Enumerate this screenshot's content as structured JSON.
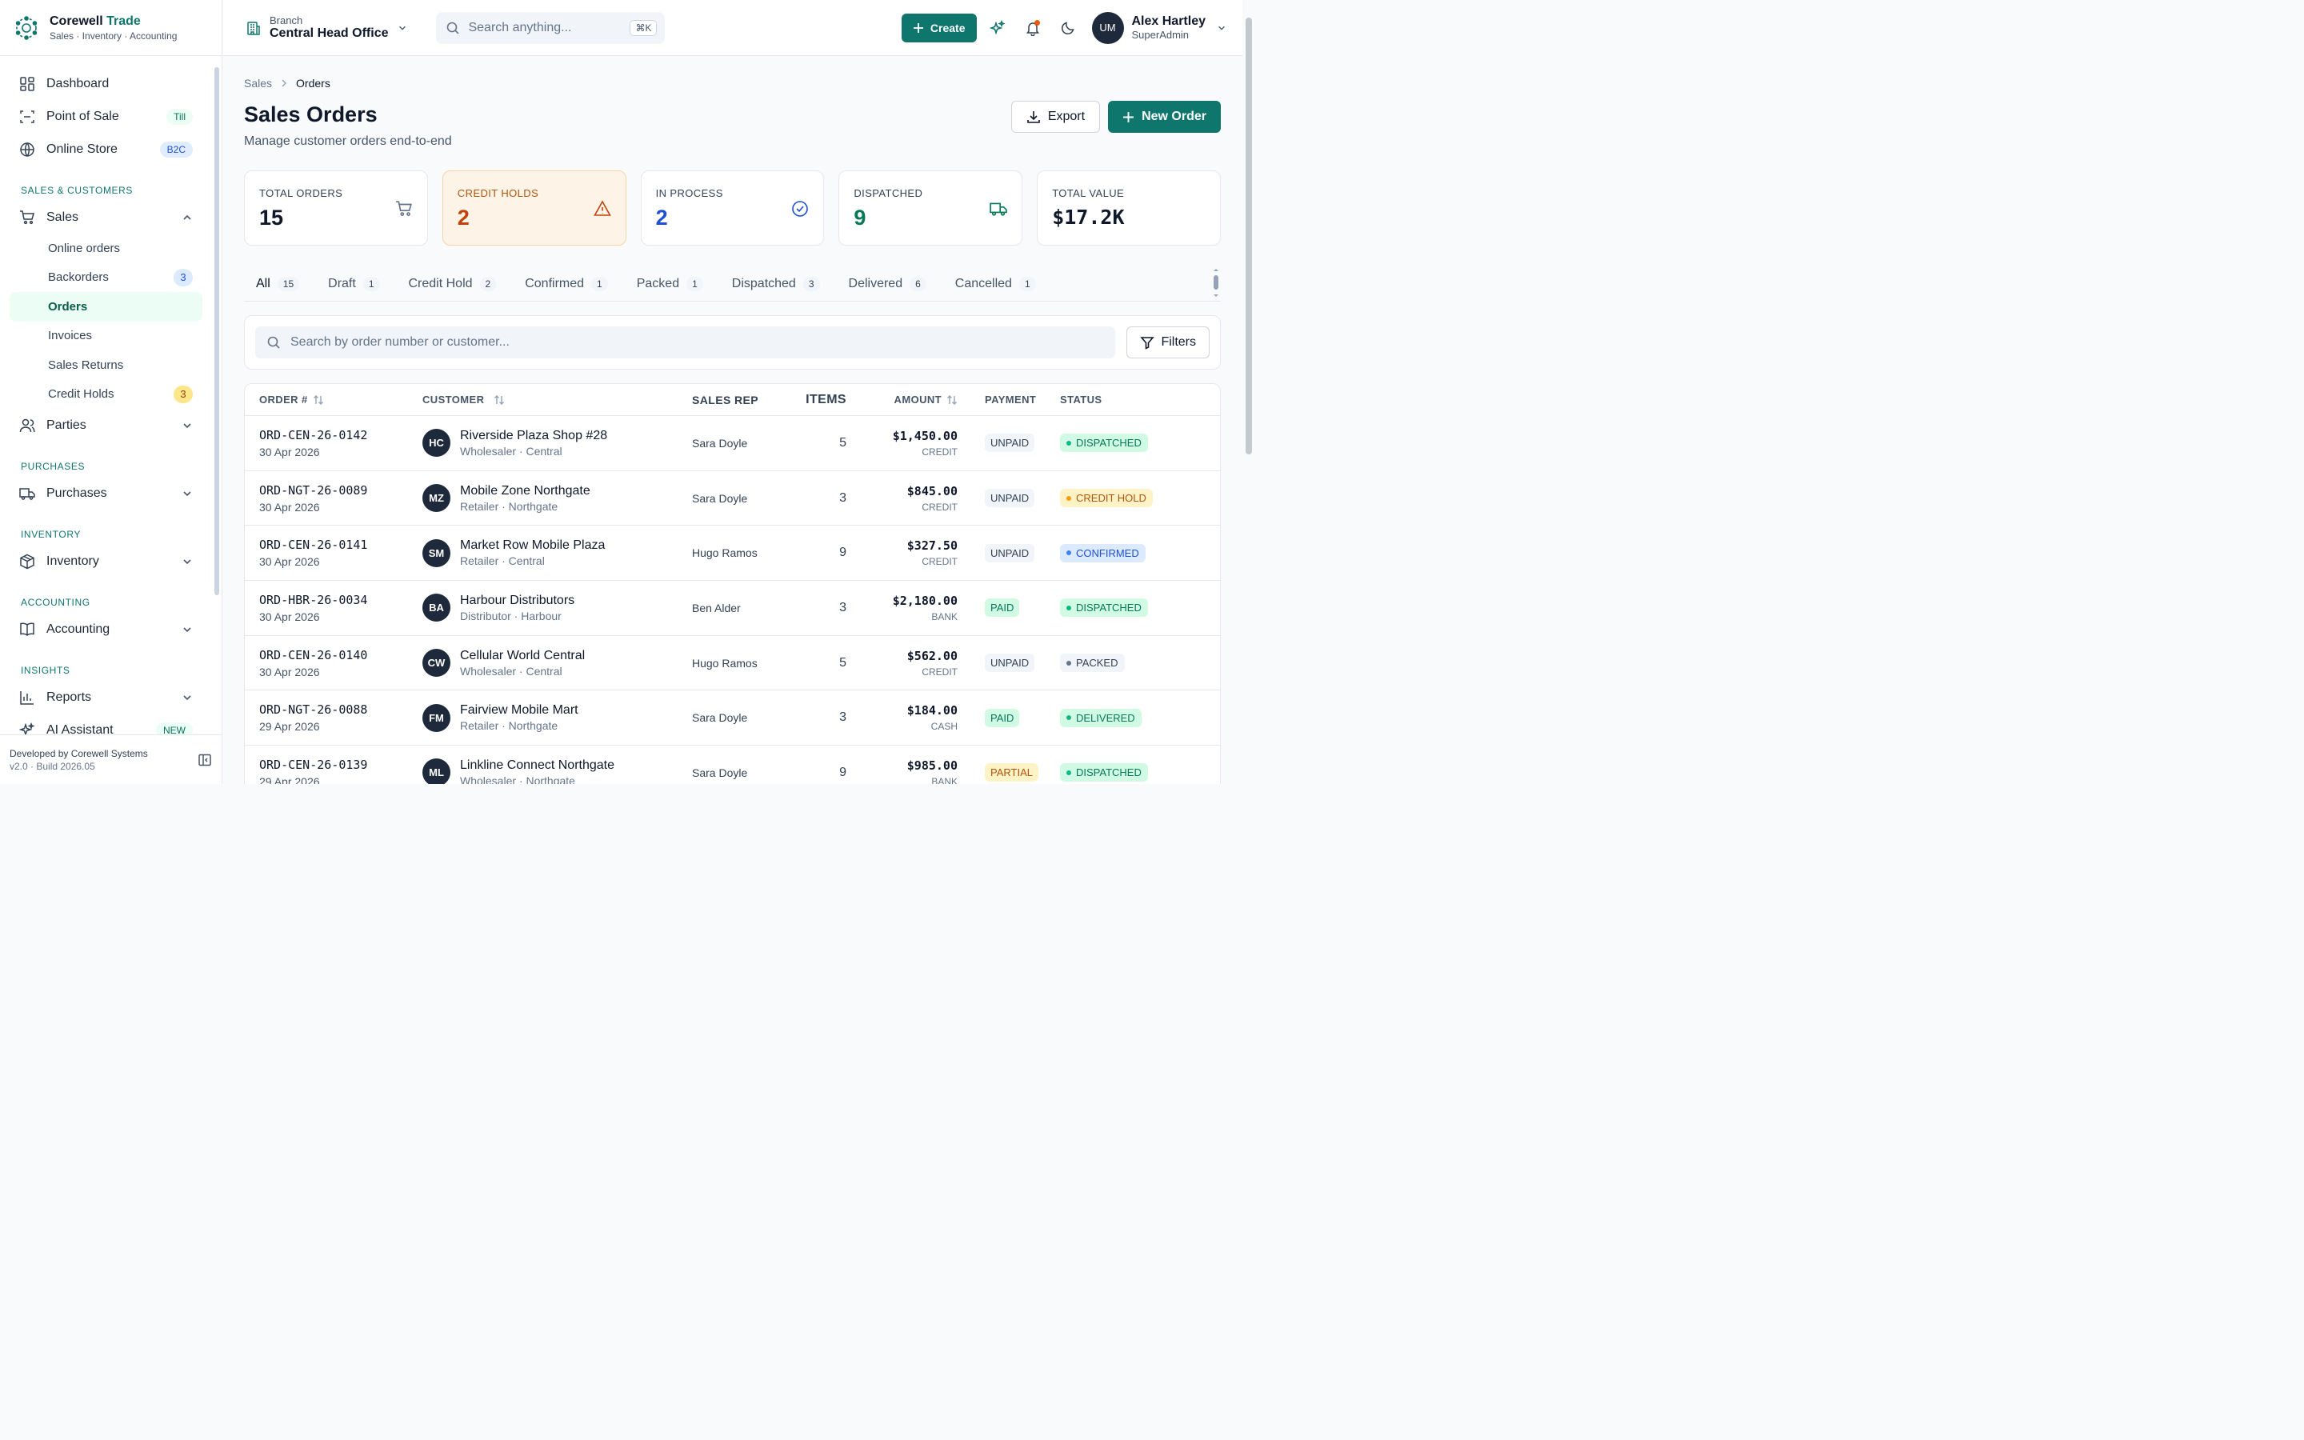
{
  "brand": {
    "name_main": "Corewell",
    "name_accent": "Trade",
    "tagline": "Sales · Inventory · Accounting"
  },
  "sidebar": {
    "items_top": [
      {
        "label": "Dashboard",
        "icon": "dashboard-icon"
      },
      {
        "label": "Point of Sale",
        "icon": "scan-icon",
        "pill": "Till"
      },
      {
        "label": "Online Store",
        "icon": "globe-icon",
        "pill": "B2C"
      }
    ],
    "section_sales": "SALES & CUSTOMERS",
    "sales": {
      "label": "Sales",
      "icon": "cart-icon"
    },
    "sales_sub": [
      {
        "label": "Online orders"
      },
      {
        "label": "Backorders",
        "count": "3"
      },
      {
        "label": "Orders"
      },
      {
        "label": "Invoices"
      },
      {
        "label": "Sales Returns"
      },
      {
        "label": "Credit Holds",
        "count": "3"
      }
    ],
    "parties": "Parties",
    "section_purchases": "PURCHASES",
    "purchases": "Purchases",
    "section_inventory": "INVENTORY",
    "inventory": "Inventory",
    "section_accounting": "ACCOUNTING",
    "accounting": "Accounting",
    "section_insights": "INSIGHTS",
    "reports": "Reports",
    "ai_assistant": "AI Assistant",
    "ai_badge": "NEW",
    "footer_line1": "Developed by Corewell Systems",
    "footer_line2": "v2.0 · Build 2026.05"
  },
  "topbar": {
    "branch_label": "Branch",
    "branch_value": "Central Head Office",
    "search_placeholder": "Search anything...",
    "search_shortcut": "⌘K",
    "create_label": "Create",
    "user_initials": "UM",
    "user_name": "Alex Hartley",
    "user_role": "SuperAdmin"
  },
  "page": {
    "breadcrumb_parent": "Sales",
    "breadcrumb_current": "Orders",
    "title": "Sales Orders",
    "subtitle": "Manage customer orders end-to-end",
    "export_label": "Export",
    "new_order_label": "New Order"
  },
  "stats": [
    {
      "label": "TOTAL ORDERS",
      "value": "15",
      "icon": "cart-icon"
    },
    {
      "label": "CREDIT HOLDS",
      "value": "2",
      "icon": "warning-icon"
    },
    {
      "label": "IN PROCESS",
      "value": "2",
      "icon": "check-circle-icon"
    },
    {
      "label": "DISPATCHED",
      "value": "9",
      "icon": "truck-icon"
    },
    {
      "label": "TOTAL VALUE",
      "value": "$17.2K"
    }
  ],
  "tabs": [
    {
      "label": "All",
      "count": "15"
    },
    {
      "label": "Draft",
      "count": "1"
    },
    {
      "label": "Credit Hold",
      "count": "2"
    },
    {
      "label": "Confirmed",
      "count": "1"
    },
    {
      "label": "Packed",
      "count": "1"
    },
    {
      "label": "Dispatched",
      "count": "3"
    },
    {
      "label": "Delivered",
      "count": "6"
    },
    {
      "label": "Cancelled",
      "count": "1"
    }
  ],
  "filter": {
    "search_placeholder": "Search by order number or customer...",
    "filters_label": "Filters"
  },
  "table": {
    "headers": {
      "order": "ORDER #",
      "customer": "CUSTOMER",
      "rep": "SALES REP",
      "items": "ITEMS",
      "amount": "AMOUNT",
      "payment": "PAYMENT",
      "status": "STATUS"
    },
    "rows": [
      {
        "order": "ORD-CEN-26-0142",
        "date": "30 Apr 2026",
        "initials": "HC",
        "customer": "Riverside Plaza Shop #28",
        "meta": "Wholesaler · Central",
        "rep": "Sara Doyle",
        "items": "5",
        "amount": "$1,450.00",
        "method": "CREDIT",
        "payment": "UNPAID",
        "status": "DISPATCHED"
      },
      {
        "order": "ORD-NGT-26-0089",
        "date": "30 Apr 2026",
        "initials": "MZ",
        "customer": "Mobile Zone Northgate",
        "meta": "Retailer · Northgate",
        "rep": "Sara Doyle",
        "items": "3",
        "amount": "$845.00",
        "method": "CREDIT",
        "payment": "UNPAID",
        "status": "CREDIT HOLD"
      },
      {
        "order": "ORD-CEN-26-0141",
        "date": "30 Apr 2026",
        "initials": "SM",
        "customer": "Market Row Mobile Plaza",
        "meta": "Retailer · Central",
        "rep": "Hugo Ramos",
        "items": "9",
        "amount": "$327.50",
        "method": "CREDIT",
        "payment": "UNPAID",
        "status": "CONFIRMED"
      },
      {
        "order": "ORD-HBR-26-0034",
        "date": "30 Apr 2026",
        "initials": "BA",
        "customer": "Harbour Distributors",
        "meta": "Distributor · Harbour",
        "rep": "Ben Alder",
        "items": "3",
        "amount": "$2,180.00",
        "method": "BANK",
        "payment": "PAID",
        "status": "DISPATCHED"
      },
      {
        "order": "ORD-CEN-26-0140",
        "date": "30 Apr 2026",
        "initials": "CW",
        "customer": "Cellular World Central",
        "meta": "Wholesaler · Central",
        "rep": "Hugo Ramos",
        "items": "5",
        "amount": "$562.00",
        "method": "CREDIT",
        "payment": "UNPAID",
        "status": "PACKED"
      },
      {
        "order": "ORD-NGT-26-0088",
        "date": "29 Apr 2026",
        "initials": "FM",
        "customer": "Fairview Mobile Mart",
        "meta": "Retailer · Northgate",
        "rep": "Sara Doyle",
        "items": "3",
        "amount": "$184.00",
        "method": "CASH",
        "payment": "PAID",
        "status": "DELIVERED"
      },
      {
        "order": "ORD-CEN-26-0139",
        "date": "29 Apr 2026",
        "initials": "ML",
        "customer": "Linkline Connect Northgate",
        "meta": "Wholesaler · Northgate",
        "rep": "Sara Doyle",
        "items": "9",
        "amount": "$985.00",
        "method": "BANK",
        "payment": "PARTIAL",
        "status": "DISPATCHED"
      }
    ]
  },
  "colors": {
    "brand": "#0f766e",
    "warning": "#c2410c",
    "info": "#1d4ed8"
  }
}
